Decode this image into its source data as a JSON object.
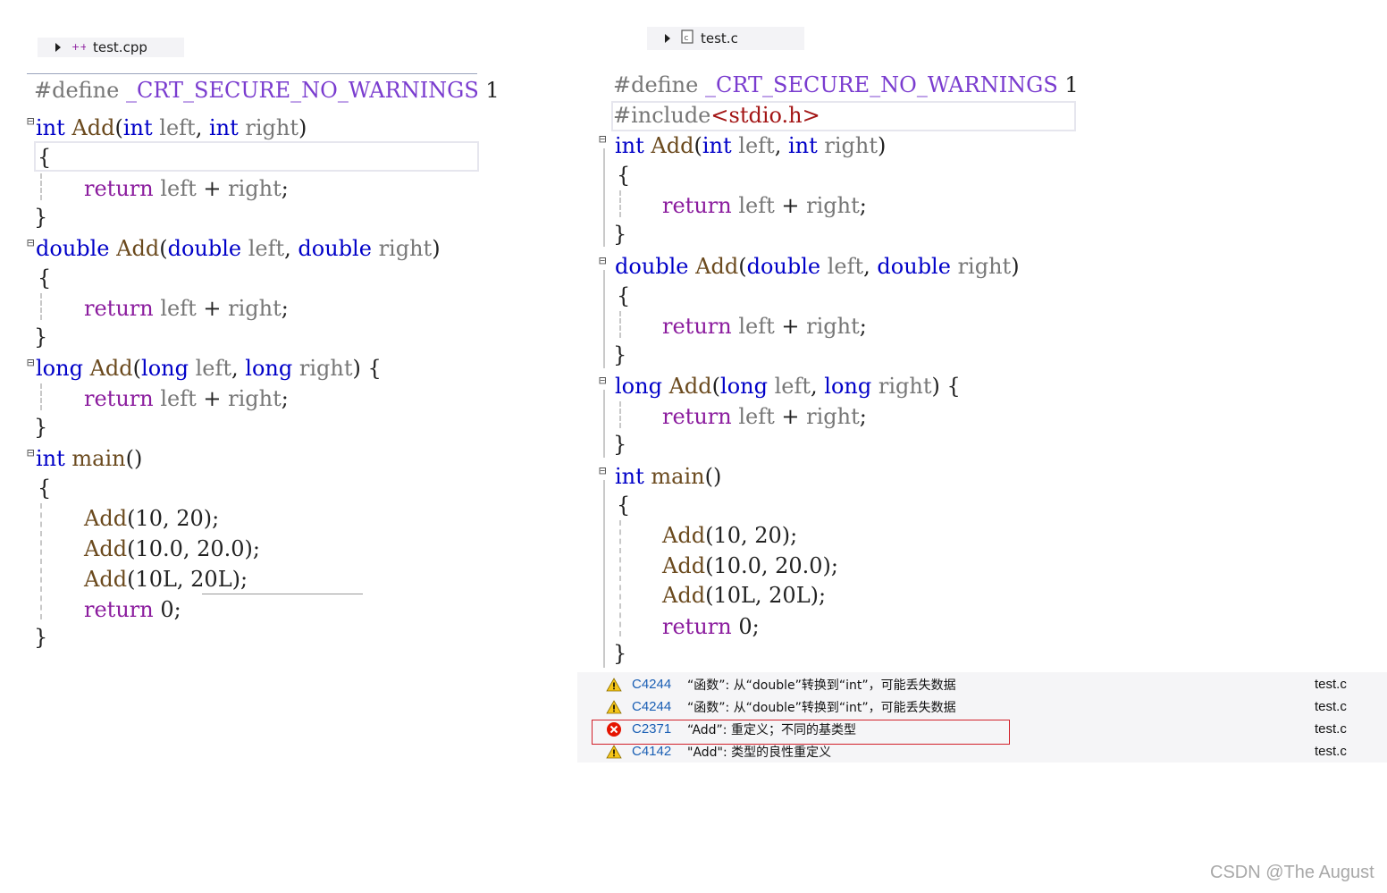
{
  "left_tab": {
    "filename": "test.cpp",
    "icon": "cpp-file-icon"
  },
  "right_tab": {
    "filename": "test.c",
    "icon": "c-file-icon"
  },
  "left_code": [
    "#define _CRT_SECURE_NO_WARNINGS 1",
    "int Add(int left, int right)",
    "{",
    "return left + right;",
    "}",
    "double Add(double left, double right)",
    "{",
    "return left + right;",
    "}",
    "long Add(long left, long right) {",
    "return left + right;",
    "}",
    "int main()",
    "{",
    "Add(10, 20);",
    "Add(10.0, 20.0);",
    "Add(10L, 20L);",
    "return 0;",
    "}"
  ],
  "right_code": [
    "#define _CRT_SECURE_NO_WARNINGS 1",
    "#include<stdio.h>",
    "int Add(int left, int right)",
    "{",
    "return left + right;",
    "}",
    "double Add(double left, double right)",
    "{",
    "return left + right;",
    "}",
    "long Add(long left, long right) {",
    "return left + right;",
    "}",
    "int main()",
    "{",
    "Add(10, 20);",
    "Add(10.0, 20.0);",
    "Add(10L, 20L);",
    "return 0;",
    "}"
  ],
  "errors": [
    {
      "severity": "warning",
      "code": "C4244",
      "message": "“函数”: 从“double”转换到“int”，可能丢失数据",
      "file": "test.c"
    },
    {
      "severity": "warning",
      "code": "C4244",
      "message": "“函数”: 从“double”转换到“int”，可能丢失数据",
      "file": "test.c"
    },
    {
      "severity": "error",
      "code": "C2371",
      "message": "“Add”: 重定义；不同的基类型",
      "file": "test.c"
    },
    {
      "severity": "warning",
      "code": "C4142",
      "message": "\"Add\": 类型的良性重定义",
      "file": "test.c"
    }
  ],
  "colors": {
    "keyword": "#0000c8",
    "return_keyword": "#8b1c9e",
    "macro": "#7a3ccf",
    "function": "#6b4a1e",
    "error_highlight": "#d2202a",
    "error_code_link": "#1a5fb4"
  },
  "watermark": "CSDN @The   August"
}
